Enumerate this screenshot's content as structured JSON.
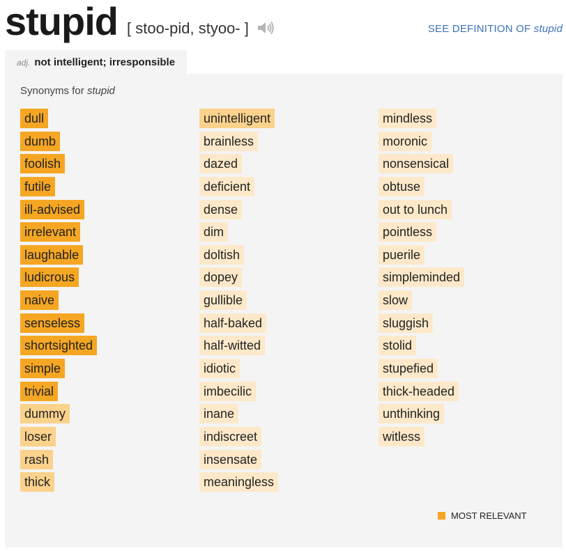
{
  "header": {
    "word": "stupid",
    "pronunciation": "[ stoo-pid, styoo- ]",
    "see_definition_label": "SEE DEFINITION OF",
    "see_definition_word": "stupid",
    "speaker_icon": "speaker-icon"
  },
  "tab": {
    "pos": "adj.",
    "definition": "not intelligent; irresponsible"
  },
  "synonyms": {
    "heading_prefix": "Synonyms for",
    "heading_word": "stupid",
    "columns": [
      [
        {
          "w": "dull",
          "rel": "high"
        },
        {
          "w": "dumb",
          "rel": "high"
        },
        {
          "w": "foolish",
          "rel": "high"
        },
        {
          "w": "futile",
          "rel": "high"
        },
        {
          "w": "ill-advised",
          "rel": "high"
        },
        {
          "w": "irrelevant",
          "rel": "high"
        },
        {
          "w": "laughable",
          "rel": "high"
        },
        {
          "w": "ludicrous",
          "rel": "high"
        },
        {
          "w": "naive",
          "rel": "high"
        },
        {
          "w": "senseless",
          "rel": "high"
        },
        {
          "w": "shortsighted",
          "rel": "high"
        },
        {
          "w": "simple",
          "rel": "high"
        },
        {
          "w": "trivial",
          "rel": "high"
        },
        {
          "w": "dummy",
          "rel": "mid"
        },
        {
          "w": "loser",
          "rel": "mid"
        },
        {
          "w": "rash",
          "rel": "mid"
        },
        {
          "w": "thick",
          "rel": "mid"
        }
      ],
      [
        {
          "w": "unintelligent",
          "rel": "mid"
        },
        {
          "w": "brainless",
          "rel": "low"
        },
        {
          "w": "dazed",
          "rel": "low"
        },
        {
          "w": "deficient",
          "rel": "low"
        },
        {
          "w": "dense",
          "rel": "low"
        },
        {
          "w": "dim",
          "rel": "low"
        },
        {
          "w": "doltish",
          "rel": "low"
        },
        {
          "w": "dopey",
          "rel": "low"
        },
        {
          "w": "gullible",
          "rel": "low"
        },
        {
          "w": "half-baked",
          "rel": "low"
        },
        {
          "w": "half-witted",
          "rel": "low"
        },
        {
          "w": "idiotic",
          "rel": "low"
        },
        {
          "w": "imbecilic",
          "rel": "low"
        },
        {
          "w": "inane",
          "rel": "low"
        },
        {
          "w": "indiscreet",
          "rel": "low"
        },
        {
          "w": "insensate",
          "rel": "low"
        },
        {
          "w": "meaningless",
          "rel": "low"
        }
      ],
      [
        {
          "w": "mindless",
          "rel": "low"
        },
        {
          "w": "moronic",
          "rel": "low"
        },
        {
          "w": "nonsensical",
          "rel": "low"
        },
        {
          "w": "obtuse",
          "rel": "low"
        },
        {
          "w": "out to lunch",
          "rel": "low"
        },
        {
          "w": "pointless",
          "rel": "low"
        },
        {
          "w": "puerile",
          "rel": "low"
        },
        {
          "w": "simpleminded",
          "rel": "low"
        },
        {
          "w": "slow",
          "rel": "low"
        },
        {
          "w": "sluggish",
          "rel": "low"
        },
        {
          "w": "stolid",
          "rel": "low"
        },
        {
          "w": "stupefied",
          "rel": "low"
        },
        {
          "w": "thick-headed",
          "rel": "low"
        },
        {
          "w": "unthinking",
          "rel": "low"
        },
        {
          "w": "witless",
          "rel": "low"
        }
      ]
    ]
  },
  "legend": {
    "label": "MOST RELEVANT"
  },
  "colors": {
    "most_relevant": "#f5a623",
    "relevant": "#fbd28c",
    "less_relevant": "#fde9c9",
    "link": "#3d72b8",
    "panel_bg": "#f4f4f4"
  }
}
